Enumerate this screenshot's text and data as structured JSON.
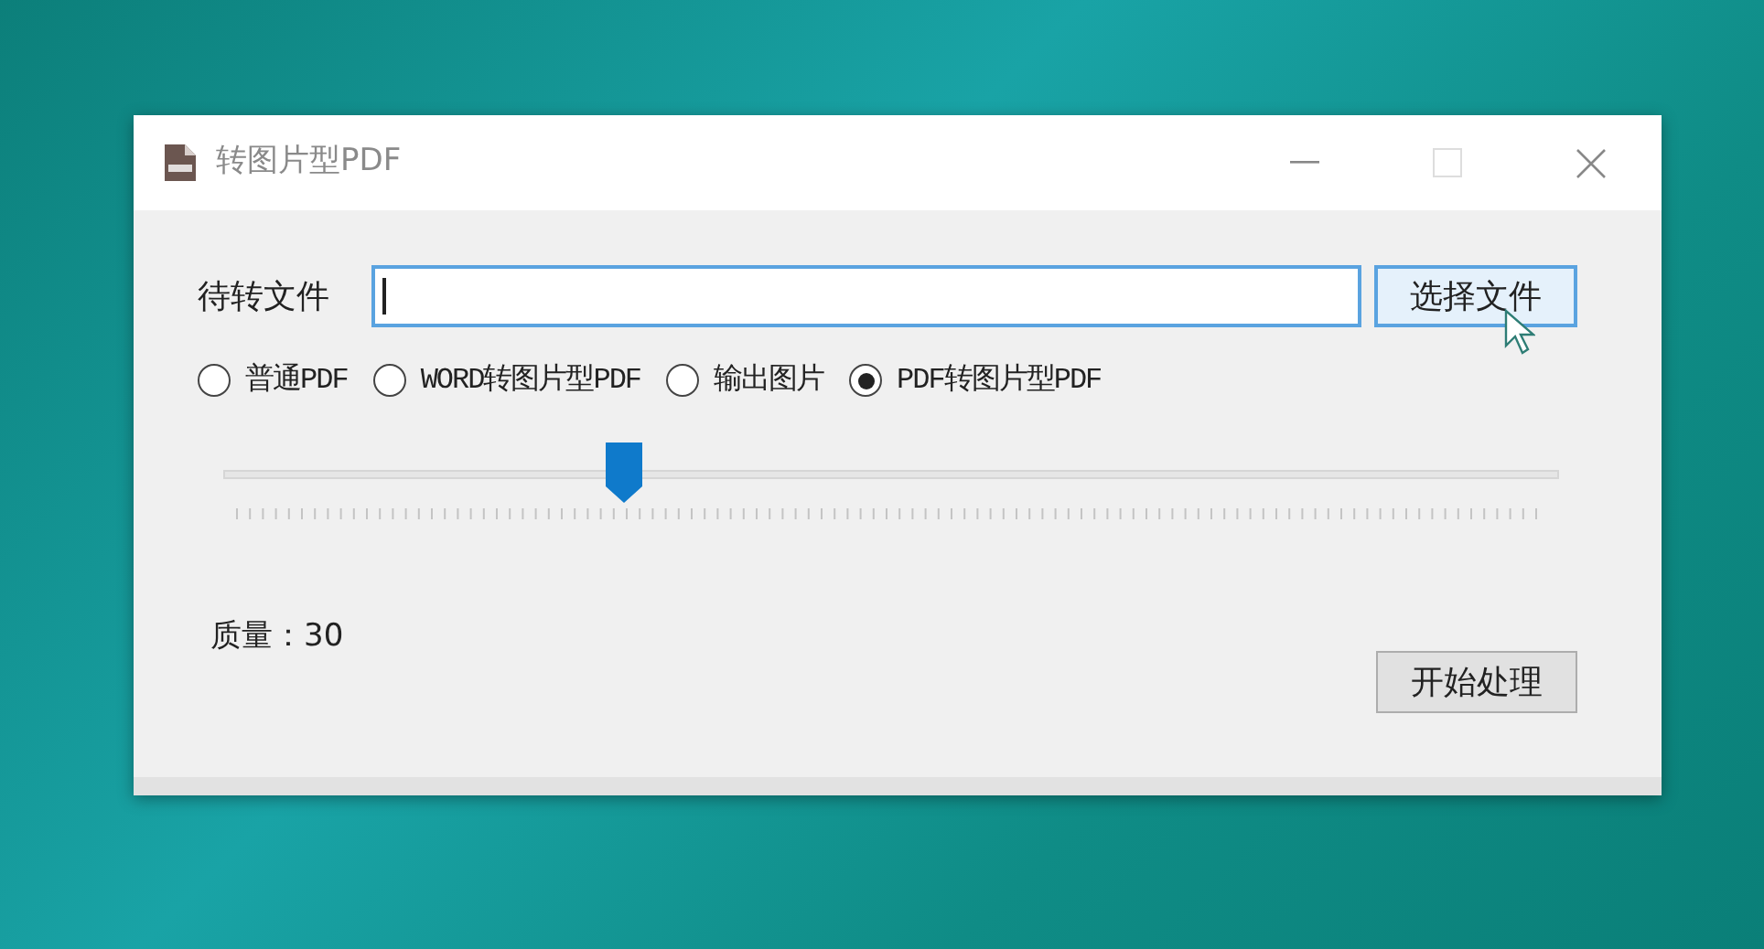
{
  "window": {
    "title": "转图片型PDF"
  },
  "file_row": {
    "label": "待转文件",
    "button": "选择文件"
  },
  "modes": [
    {
      "label": "普通PDF",
      "selected": false
    },
    {
      "label": "WORD转图片型PDF",
      "selected": false
    },
    {
      "label": "输出图片",
      "selected": false
    },
    {
      "label": "PDF转图片型PDF",
      "selected": true
    }
  ],
  "quality_slider": {
    "level": 0.3
  },
  "quality_label": "质量：30",
  "start_button": "开始处理"
}
